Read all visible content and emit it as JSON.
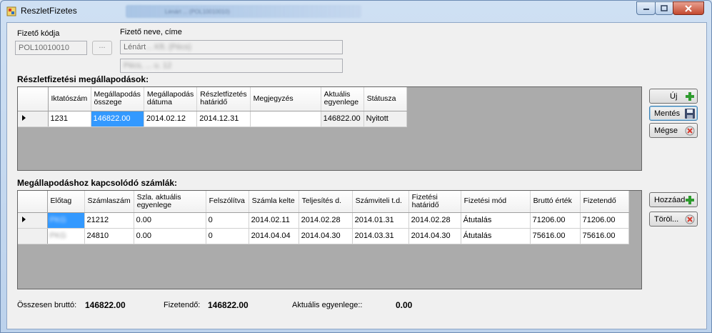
{
  "window": {
    "title": "ReszletFizetes",
    "blurred_caption": "Lénárt ... (POL10010010)"
  },
  "payer": {
    "code_label": "Fizető kódja",
    "code_value": "POL10010010",
    "browse_label": "...",
    "name_label": "Fizető neve, címe",
    "name_value": "Lénárt",
    "name_blurred": "... Kft. (Pécs)",
    "address_blurred": "Pécs, ... u. 12"
  },
  "agreements": {
    "section_title": "Részletfizetési megállapodások:",
    "columns": [
      "Iktatószám",
      "Megállapodás összege",
      "Megállapodás dátuma",
      "Részletfizetés határidő",
      "Megjegyzés",
      "Aktuális egyenlege",
      "Státusza"
    ],
    "rows": [
      {
        "iktatoszam": "1231",
        "osszeg": "146822.00",
        "datum": "2014.02.12",
        "hatarido": "2014.12.31",
        "megjegyzes": "",
        "egyenleg": "146822.00",
        "statusz": "Nyitott"
      }
    ]
  },
  "buttons": {
    "new": "Új",
    "save": "Mentés",
    "cancel": "Mégse",
    "add": "Hozzáad",
    "delete": "Töröl..."
  },
  "invoices": {
    "section_title": "Megállapodáshoz kapcsolódó számlák:",
    "columns": [
      "Előtag",
      "Számlaszám",
      "Szla. aktuális egyenlege",
      "Felszólítva",
      "Számla kelte",
      "Teljesítés d.",
      "Számviteli t.d.",
      "Fizetési határidő",
      "Fizetési mód",
      "Bruttó érték",
      "Fizetendő"
    ],
    "rows": [
      {
        "elotag": "PKG",
        "szamlaszam": "21212",
        "egyenleg": "0.00",
        "felszolitva": "0",
        "kelte": "2014.02.11",
        "teljesites": "2014.02.28",
        "szamviteli": "2014.01.31",
        "hatarido": "2014.02.28",
        "mod": "Átutalás",
        "brutto": "71206.00",
        "fizetendo": "71206.00"
      },
      {
        "elotag": "PKG",
        "szamlaszam": "24810",
        "egyenleg": "0.00",
        "felszolitva": "0",
        "kelte": "2014.04.04",
        "teljesites": "2014.04.30",
        "szamviteli": "2014.03.31",
        "hatarido": "2014.04.30",
        "mod": "Átutalás",
        "brutto": "75616.00",
        "fizetendo": "75616.00"
      }
    ]
  },
  "totals": {
    "gross_label": "Összesen bruttó:",
    "gross_value": "146822.00",
    "payable_label": "Fizetendő:",
    "payable_value": "146822.00",
    "balance_label": "Aktuális egyenlege::",
    "balance_value": "0.00"
  },
  "colors": {
    "selection": "#3399ff",
    "grid_bg": "#ababab",
    "add_icon": "#2e9b2e",
    "cancel_icon": "#d9382c"
  }
}
